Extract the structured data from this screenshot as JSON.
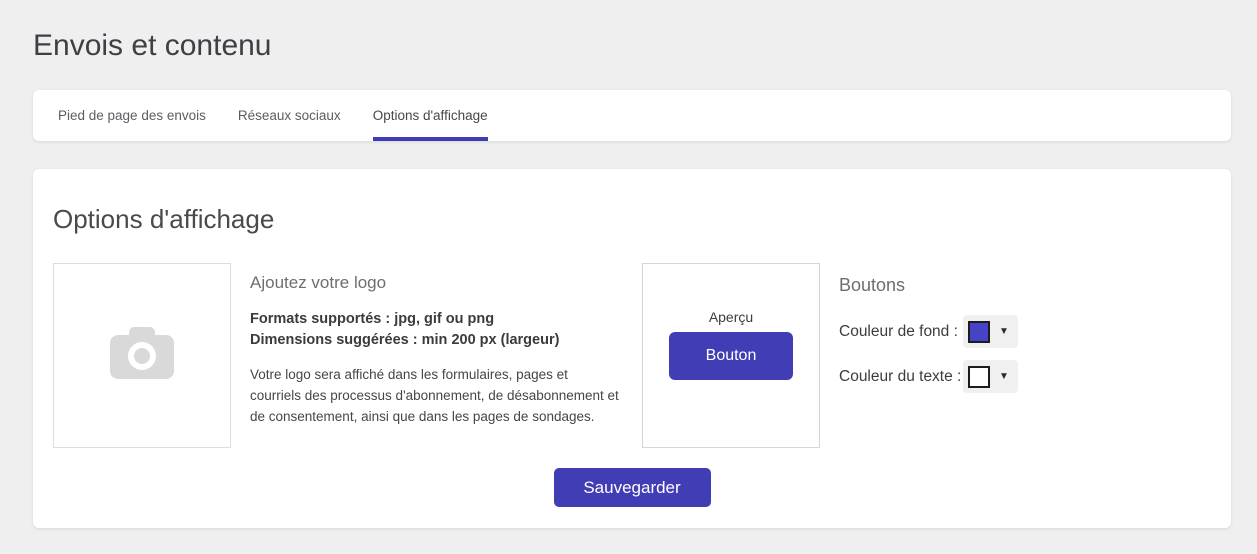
{
  "page": {
    "title": "Envois et contenu",
    "background_color": "#efefef",
    "accent_color": "#413eb5"
  },
  "tabs": [
    {
      "label": "Pied de page des envois",
      "active": false
    },
    {
      "label": "Réseaux sociaux",
      "active": false
    },
    {
      "label": "Options d'affichage",
      "active": true
    }
  ],
  "panel": {
    "heading": "Options d'affichage",
    "logo": {
      "icon": "camera-icon",
      "heading": "Ajoutez votre logo",
      "formats_line": "Formats supportés : jpg, gif ou png",
      "dimensions_line": "Dimensions suggérées : min 200 px (largeur)",
      "description": "Votre logo sera affiché dans les formulaires, pages et courriels des processus d'abonnement, de désabonnement et de consentement, ainsi que dans les pages de sondages."
    },
    "preview": {
      "label": "Aperçu",
      "button_label": "Bouton"
    },
    "buttons_section": {
      "heading": "Boutons",
      "background_color_label": "Couleur de fond :",
      "background_color_value": "#4743c6",
      "text_color_label": "Couleur du texte :",
      "text_color_value": "#ffffff",
      "dropdown_arrow": "▼"
    },
    "save_label": "Sauvegarder"
  }
}
